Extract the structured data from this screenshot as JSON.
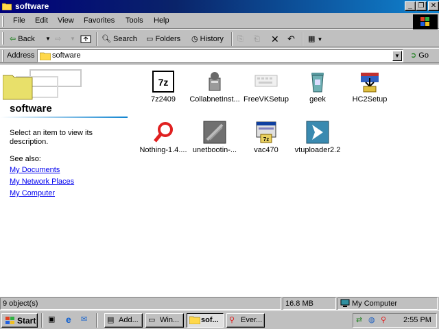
{
  "window": {
    "title": "software",
    "buttons": {
      "minimize": "_",
      "maximize": "❐",
      "close": "✕"
    }
  },
  "menu": [
    "File",
    "Edit",
    "View",
    "Favorites",
    "Tools",
    "Help"
  ],
  "toolbar": {
    "back": "Back",
    "search": "Search",
    "folders": "Folders",
    "history": "History"
  },
  "address": {
    "label": "Address",
    "value": "software",
    "go": "Go"
  },
  "left_pane": {
    "title": "software",
    "description": "Select an item to view its description.",
    "see_also": "See also:",
    "links": [
      "My Documents",
      "My Network Places",
      "My Computer"
    ]
  },
  "files": [
    {
      "name": "7z2409",
      "icon": "7zip-icon"
    },
    {
      "name": "CollabnetInst...",
      "icon": "installer-icon"
    },
    {
      "name": "FreeVKSetup",
      "icon": "keyboard-icon"
    },
    {
      "name": "geek",
      "icon": "trash-icon"
    },
    {
      "name": "HC2Setup",
      "icon": "setup-box-icon"
    },
    {
      "name": "Nothing-1.4....",
      "icon": "magnifier-icon"
    },
    {
      "name": "unetbootin-...",
      "icon": "unetbootin-icon"
    },
    {
      "name": "vac470",
      "icon": "7zip-window-icon"
    },
    {
      "name": "vtuploader2.2",
      "icon": "arrow-app-icon"
    }
  ],
  "status": {
    "count": "9 object(s)",
    "size": "16.8 MB",
    "zone": "My Computer"
  },
  "taskbar": {
    "start": "Start",
    "tasks": [
      "Add...",
      "Win...",
      "sof...",
      "Ever..."
    ],
    "clock": "2:55 PM"
  },
  "colors": {
    "title_start": "#00007b",
    "title_end": "#1084d0",
    "face": "#c0c0c0",
    "link": "#0000ee"
  }
}
